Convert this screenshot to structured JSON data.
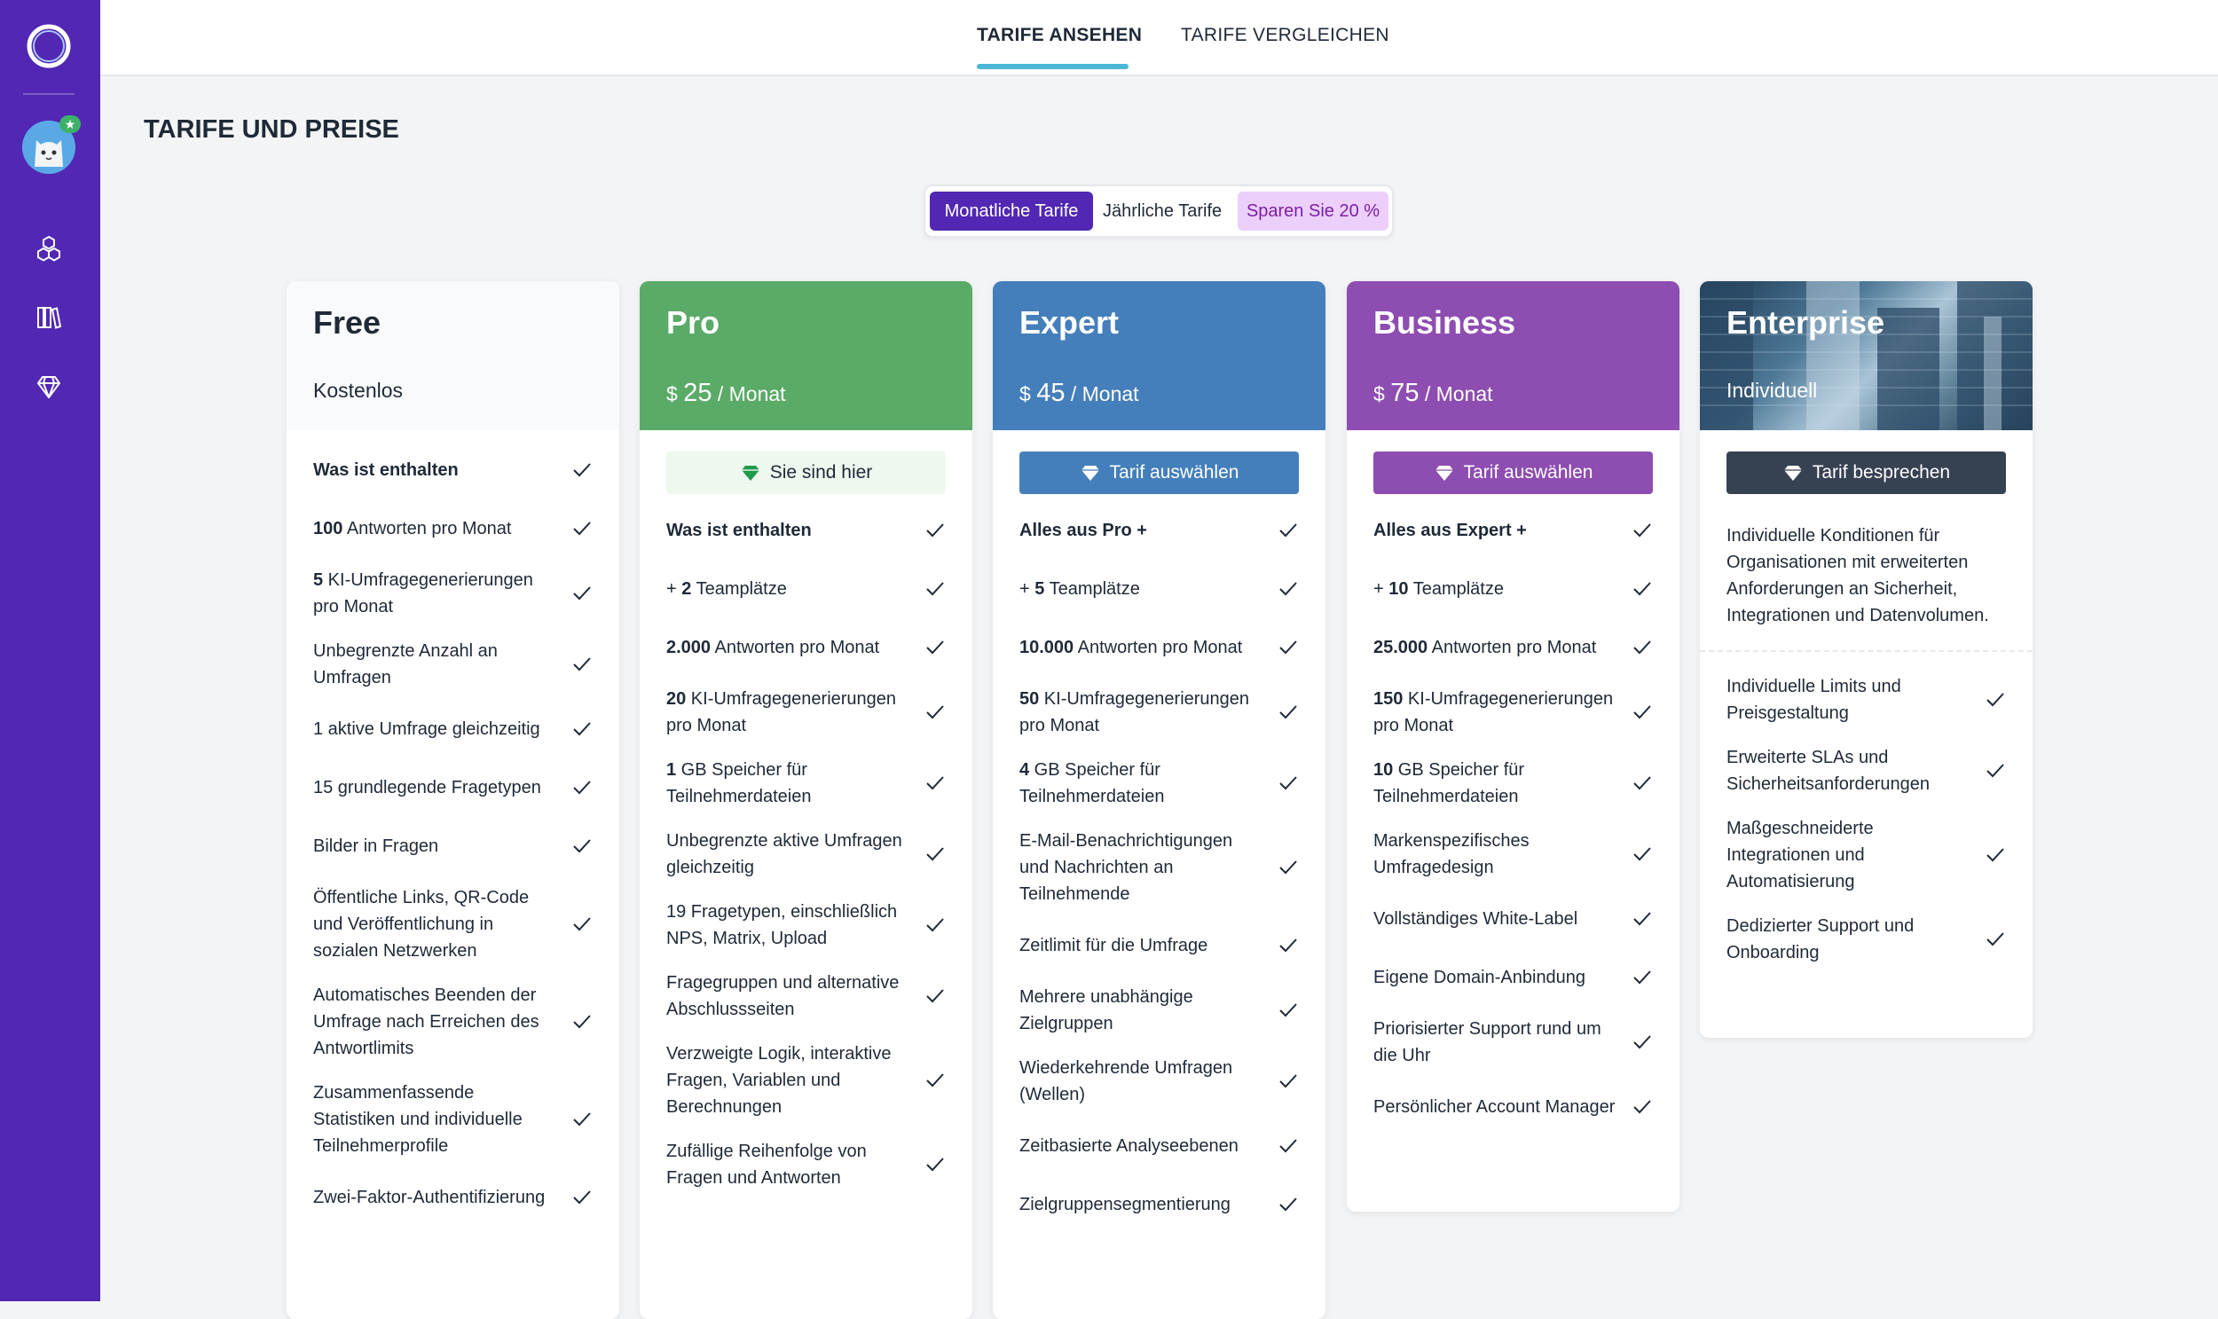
{
  "topbar": {
    "tabs": [
      {
        "label": "TARIFE ANSEHEN",
        "active": true
      },
      {
        "label": "TARIFE VERGLEICHEN",
        "active": false
      }
    ]
  },
  "page": {
    "title": "TARIFE UND PREISE"
  },
  "billing_toggle": {
    "monthly": "Monatliche Tarife",
    "yearly": "Jährliche Tarife",
    "save": "Sparen Sie 20 %"
  },
  "sidebar": {
    "icons": [
      "app-logo-icon",
      "user-avatar",
      "dashboard-icon",
      "library-icon",
      "diamond-icon"
    ],
    "badge": "★"
  },
  "colors": {
    "sidebar": "#5127b3",
    "pro": "#5aab67",
    "expert": "#447fbb",
    "business": "#8e4db1",
    "enterprise_button": "#364152",
    "accent_tab": "#4bb6d6"
  },
  "plans": [
    {
      "name": "Free",
      "price_label": "Kostenlos",
      "features": [
        {
          "bold": "Was ist enthalten",
          "text": ""
        },
        {
          "bold": "100",
          "text": " Antworten pro Monat"
        },
        {
          "bold": "5",
          "text": " KI-Umfragegenerierungen pro Monat"
        },
        {
          "bold": "",
          "text": "Unbegrenzte Anzahl an Umfragen"
        },
        {
          "bold": "",
          "text": "1 aktive Umfrage gleichzeitig"
        },
        {
          "bold": "",
          "text": "15 grundlegende Fragetypen"
        },
        {
          "bold": "",
          "text": "Bilder in Fragen"
        },
        {
          "bold": "",
          "text": "Öffentliche Links, QR-Code und Veröffentlichung in sozialen Netzwerken"
        },
        {
          "bold": "",
          "text": "Automatisches Beenden der Umfrage nach Erreichen des Antwortlimits"
        },
        {
          "bold": "",
          "text": "Zusammenfassende Statistiken und individuelle Teilnehmerprofile"
        },
        {
          "bold": "",
          "text": "Zwei-Faktor-Authentifizierung"
        }
      ]
    },
    {
      "name": "Pro",
      "currency": "$",
      "amount": "25",
      "per": " / Monat",
      "button": "Sie sind hier",
      "features": [
        {
          "bold": "Was ist enthalten",
          "text": ""
        },
        {
          "bold": "2",
          "prefix": "+ ",
          "text": " Teamplätze"
        },
        {
          "bold": "2.000",
          "text": " Antworten pro Monat"
        },
        {
          "bold": "20",
          "text": " KI-Umfragegenerierungen pro Monat"
        },
        {
          "bold": "1",
          "text": " GB Speicher für Teilnehmerdateien"
        },
        {
          "bold": "",
          "text": "Unbegrenzte aktive Umfragen gleichzeitig"
        },
        {
          "bold": "",
          "text": "19 Fragetypen, einschließlich NPS, Matrix, Upload"
        },
        {
          "bold": "",
          "text": "Fragegruppen und alternative Abschlussseiten"
        },
        {
          "bold": "",
          "text": "Verzweigte Logik, interaktive Fragen, Variablen und Berechnungen"
        },
        {
          "bold": "",
          "text": "Zufällige Reihenfolge von Fragen und Antworten"
        }
      ]
    },
    {
      "name": "Expert",
      "currency": "$",
      "amount": "45",
      "per": " / Monat",
      "button": "Tarif auswählen",
      "features": [
        {
          "bold": "Alles aus Pro +",
          "text": ""
        },
        {
          "bold": "5",
          "prefix": "+ ",
          "text": " Teamplätze"
        },
        {
          "bold": "10.000",
          "text": " Antworten pro Monat"
        },
        {
          "bold": "50",
          "text": " KI-Umfragegenerierungen pro Monat"
        },
        {
          "bold": "4",
          "text": " GB Speicher für Teilnehmerdateien"
        },
        {
          "bold": "",
          "text": "E-Mail-Benachrichtigungen und Nachrichten an Teilnehmende"
        },
        {
          "bold": "",
          "text": "Zeitlimit für die Umfrage"
        },
        {
          "bold": "",
          "text": "Mehrere unabhängige Zielgruppen"
        },
        {
          "bold": "",
          "text": "Wiederkehrende Umfragen (Wellen)"
        },
        {
          "bold": "",
          "text": "Zeitbasierte Analyseebenen"
        },
        {
          "bold": "",
          "text": "Zielgruppensegmentierung"
        }
      ]
    },
    {
      "name": "Business",
      "currency": "$",
      "amount": "75",
      "per": " / Monat",
      "button": "Tarif auswählen",
      "features": [
        {
          "bold": "Alles aus Expert +",
          "text": ""
        },
        {
          "bold": "10",
          "prefix": "+ ",
          "text": " Teamplätze"
        },
        {
          "bold": "25.000",
          "text": " Antworten pro Monat"
        },
        {
          "bold": "150",
          "text": " KI-Umfragegenerierungen pro Monat"
        },
        {
          "bold": "10",
          "text": " GB Speicher für Teilnehmerdateien"
        },
        {
          "bold": "",
          "text": "Markenspezifisches Umfragedesign"
        },
        {
          "bold": "",
          "text": "Vollständiges White-Label"
        },
        {
          "bold": "",
          "text": "Eigene Domain-Anbindung"
        },
        {
          "bold": "",
          "text": "Priorisierter Support rund um die Uhr"
        },
        {
          "bold": "",
          "text": "Persönlicher Account Manager"
        }
      ]
    },
    {
      "name": "Enterprise",
      "price_label": "Individuell",
      "button": "Tarif besprechen",
      "description": "Individuelle Konditionen für Organisationen mit erweiterten Anforderungen an Sicherheit, Integrationen und Datenvolumen.",
      "features": [
        {
          "bold": "",
          "text": "Individuelle Limits und Preisgestaltung"
        },
        {
          "bold": "",
          "text": "Erweiterte SLAs und Sicherheitsanforderungen"
        },
        {
          "bold": "",
          "text": "Maßgeschneiderte Integrationen und Automatisierung"
        },
        {
          "bold": "",
          "text": "Dedizierter Support und Onboarding"
        }
      ]
    }
  ]
}
